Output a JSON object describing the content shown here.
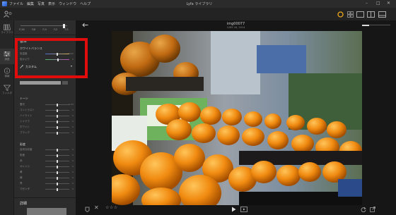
{
  "menubar": {
    "items": [
      "ファイル",
      "編集",
      "写真",
      "表示",
      "ウィンドウ",
      "ヘルプ"
    ],
    "title": "Lyfa ライブラリ"
  },
  "toolbar": {
    "view_icons": [
      "circle-view-icon",
      "grid-view-icon",
      "single-view-icon",
      "compare-view-icon",
      "filmstrip-view-icon"
    ]
  },
  "rail": [
    {
      "label": "ライブラリ",
      "icon": "library-icon"
    },
    {
      "label": "調整",
      "icon": "sliders-icon"
    },
    {
      "label": "情報",
      "icon": "info-icon"
    },
    {
      "label": "フィルタ",
      "icon": "filter-icon"
    }
  ],
  "panel": {
    "aperture_stops": [
      "F/16",
      "F/8",
      "F/4",
      "F/2",
      "F/1"
    ],
    "basic_title": "基本",
    "white_balance": {
      "title": "ホワイトバランス",
      "rows": [
        {
          "label": "色温度",
          "value": "5000"
        },
        {
          "label": "色かぶり",
          "value": "0"
        }
      ],
      "preset": "カスタム"
    },
    "tone": {
      "title": "トーン",
      "rows": [
        {
          "label": "露光",
          "value": "0.00"
        },
        {
          "label": "コントラスト",
          "value": "0"
        },
        {
          "label": "ハイライト",
          "value": "0"
        },
        {
          "label": "シャドウ",
          "value": "0"
        },
        {
          "label": "ホワイト",
          "value": "0"
        },
        {
          "label": "ブラック",
          "value": "0"
        }
      ]
    },
    "color": {
      "title": "彩度",
      "rows": [
        {
          "label": "自然な彩度",
          "value": "0"
        },
        {
          "label": "彩度",
          "value": "0"
        },
        {
          "label": "赤",
          "value": "0"
        },
        {
          "label": "オレンジ",
          "value": "0"
        },
        {
          "label": "黄",
          "value": "0"
        },
        {
          "label": "緑",
          "value": "0"
        },
        {
          "label": "青",
          "value": "0"
        },
        {
          "label": "マゼンタ",
          "value": "0"
        }
      ]
    },
    "detail_title": "詳細"
  },
  "photo": {
    "name": "img00077",
    "meta": "1285 16, 2014",
    "subject": "mandarin oranges on display"
  },
  "colors": {
    "accent": "#f0a81c",
    "highlight_box": "#e10c0c"
  }
}
